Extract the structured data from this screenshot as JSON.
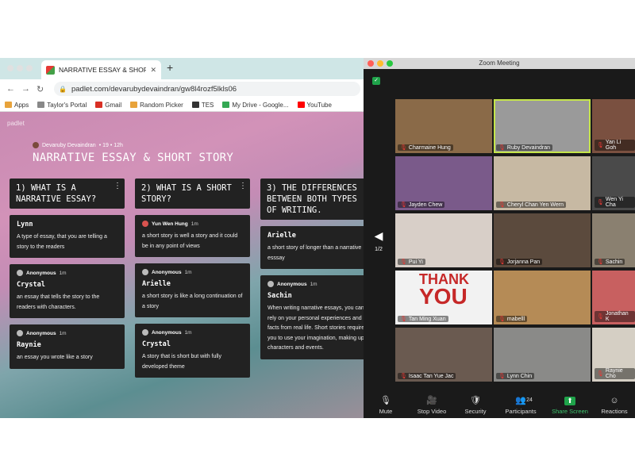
{
  "browser": {
    "tab_title": "NARRATIVE ESSAY & SHORT S",
    "url": "padlet.com/devarubydevaindran/gw8l4rozf5lkls06",
    "bookmarks": [
      {
        "label": "Apps",
        "icon": "apps-grid-icon",
        "color": "#e8a33b"
      },
      {
        "label": "Taylor's Portal",
        "icon": "folder-icon",
        "color": "#888888"
      },
      {
        "label": "Gmail",
        "icon": "gmail-icon",
        "color": "#d93025"
      },
      {
        "label": "Random Picker",
        "icon": "wheel-icon",
        "color": "#e8a33b"
      },
      {
        "label": "TES",
        "icon": "tes-icon",
        "color": "#333333"
      },
      {
        "label": "My Drive - Google...",
        "icon": "drive-icon",
        "color": "#34a853"
      },
      {
        "label": "YouTube",
        "icon": "youtube-icon",
        "color": "#ff0000"
      }
    ]
  },
  "padlet": {
    "brand": "padlet",
    "author": "Devaruby Devaindran",
    "stats": "• 19 • 12h",
    "title": "NARRATIVE ESSAY & SHORT STORY",
    "columns": [
      {
        "heading": "1) WHAT IS A NARRATIVE ESSAY?",
        "cards": [
          {
            "meta": "",
            "time": "",
            "title": "Lynn",
            "body": "A type of essay, that you are telling a story to the readers"
          },
          {
            "meta": "Anonymous",
            "time": "1m",
            "title": "Crystal",
            "body": "an essay that tells the story to the readers with characters."
          },
          {
            "meta": "Anonymous",
            "time": "1m",
            "title": "Raynie",
            "body": "an essay you wrote like a story"
          }
        ]
      },
      {
        "heading": "2) WHAT IS A SHORT STORY?",
        "cards": [
          {
            "meta": "Yun Wen Hung",
            "time": "1m",
            "title": "",
            "body": "a short story is well a story and it could be in any point of views"
          },
          {
            "meta": "Anonymous",
            "time": "1m",
            "title": "Arielle",
            "body": "a short story is like a long continuation of a story"
          },
          {
            "meta": "Anonymous",
            "time": "1m",
            "title": "Crystal",
            "body": "A story that is short but with fully developed theme"
          }
        ]
      },
      {
        "heading": "3) THE DIFFERENCES BETWEEN BOTH TYPES OF WRITING.",
        "cards": [
          {
            "meta": "",
            "time": "",
            "title": "Arielle",
            "body": "a short story of longer than a narrative esssay"
          },
          {
            "meta": "Anonymous",
            "time": "1m",
            "title": "Sachin",
            "body": "When writing narrative essays, you can rely on your personal experiences and facts from real life. Short stories require you to use your imagination, making up characters and events."
          }
        ]
      }
    ]
  },
  "zoom": {
    "title": "Zoom Meeting",
    "page_indicator": "1/2",
    "participants": [
      {
        "name": "Charmaine Hung",
        "bg": "#8a6a48"
      },
      {
        "name": "Ruby Devaindran",
        "bg": "#9a9a9a"
      },
      {
        "name": "Yan Li Goh",
        "bg": "#7a5040"
      },
      {
        "name": "Jayden Chew",
        "bg": "#7a5a8a"
      },
      {
        "name": "Cheryl Chan Yen Wern",
        "bg": "#c7b9a3"
      },
      {
        "name": "Wen Yi Cha",
        "bg": "#4a4a4a"
      },
      {
        "name": "Pui Yi",
        "bg": "#d8cfc8"
      },
      {
        "name": "Jorjanna Pan",
        "bg": "#5b4a3d"
      },
      {
        "name": "Sachin",
        "bg": "#8a8070"
      },
      {
        "name": "Tan Ming Xuan",
        "bg": "#f2f2f2"
      },
      {
        "name": "mabelll",
        "bg": "#b58b56"
      },
      {
        "name": "Jonathan K",
        "bg": "#c86060"
      },
      {
        "name": "Isaac Tan Yue Jac",
        "bg": "#6a5a50"
      },
      {
        "name": "Lynn Chin",
        "bg": "#8a8a88"
      },
      {
        "name": "Raynie Cho",
        "bg": "#d5cfc4"
      }
    ],
    "thank_you_text": [
      "THANK",
      "YOU"
    ],
    "controls": [
      {
        "label": "Mute",
        "icon": "microphone-icon"
      },
      {
        "label": "Stop Video",
        "icon": "video-camera-icon"
      },
      {
        "label": "Security",
        "icon": "shield-icon"
      },
      {
        "label": "Participants",
        "icon": "participants-icon",
        "count": "24"
      },
      {
        "label": "Share Screen",
        "icon": "share-screen-icon"
      },
      {
        "label": "Reactions",
        "icon": "reactions-icon"
      }
    ]
  }
}
